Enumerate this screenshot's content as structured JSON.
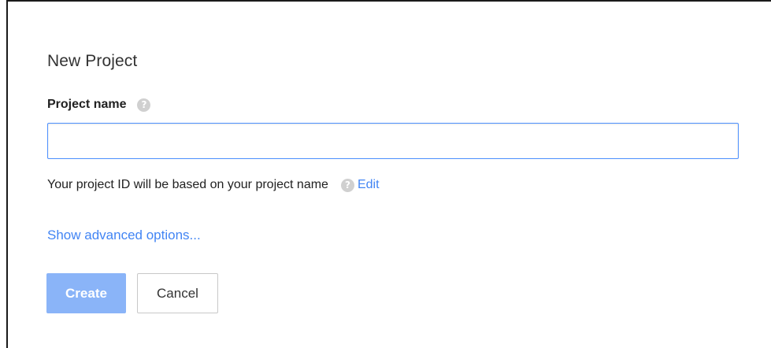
{
  "dialog": {
    "title": "New Project",
    "project_name": {
      "label": "Project name",
      "value": "",
      "placeholder": ""
    },
    "project_id": {
      "text": "Your project ID will be based on your project name",
      "edit_link": "Edit"
    },
    "advanced_link": "Show advanced options...",
    "buttons": {
      "create": "Create",
      "cancel": "Cancel"
    },
    "icons": {
      "help": "?"
    }
  },
  "colors": {
    "link": "#4285f4",
    "input_border": "#4d90fe",
    "create_button_disabled": "#8ab4f8",
    "help_icon": "#d0d0d0"
  }
}
